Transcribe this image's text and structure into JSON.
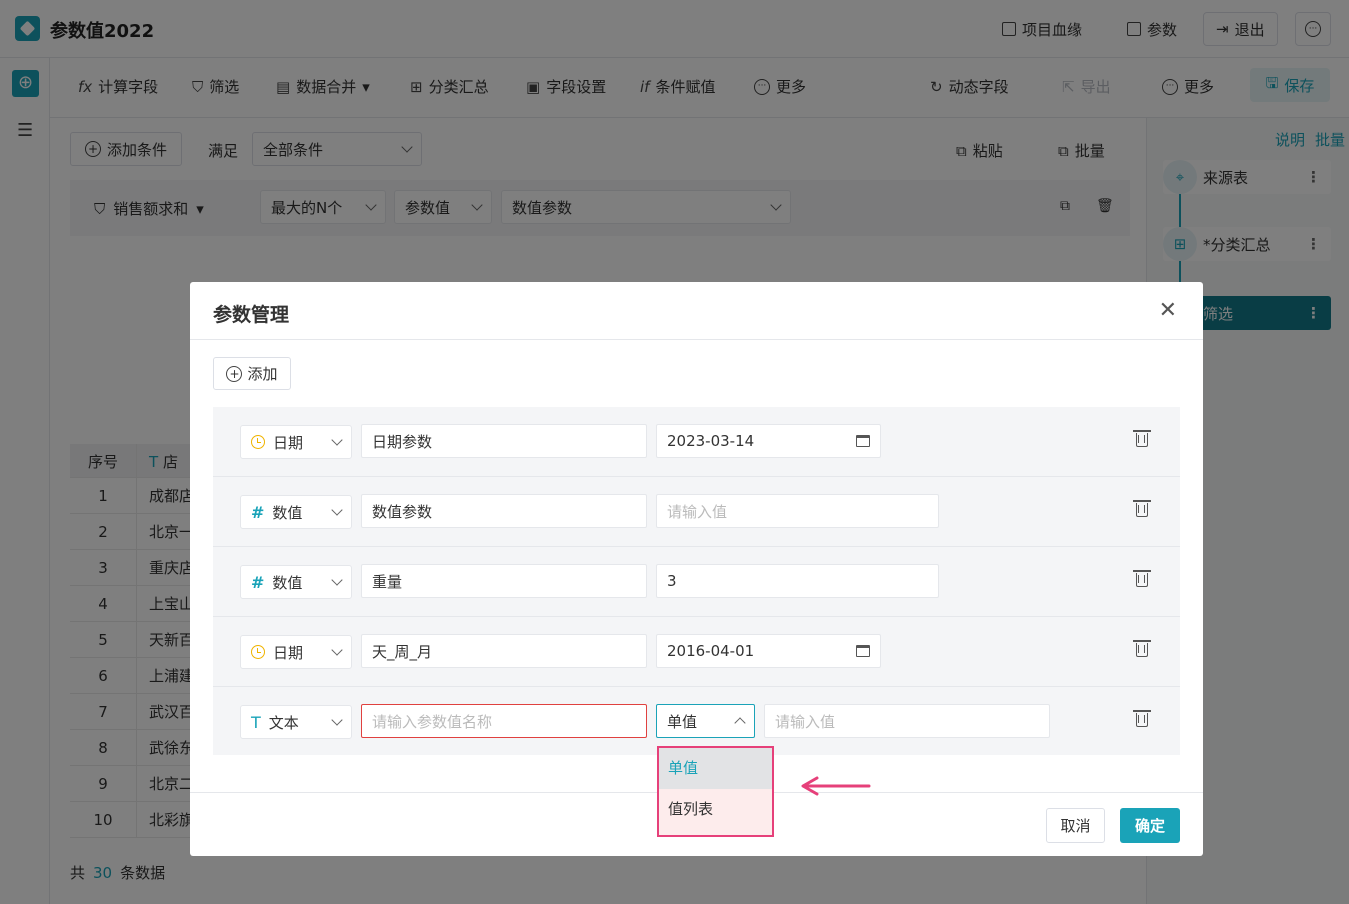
{
  "header": {
    "title": "参数值2022",
    "lineage_label": "项目血缘",
    "params_label": "参数",
    "exit_label": "退出"
  },
  "toolbar": {
    "calc_field": "计算字段",
    "filter": "筛选",
    "merge": "数据合并",
    "group_sum": "分类汇总",
    "field_settings": "字段设置",
    "conditional_assign": "条件赋值",
    "more": "更多",
    "dynamic_field": "动态字段",
    "export": "导出",
    "more2": "更多",
    "save": "保存"
  },
  "conditions": {
    "add_condition": "添加条件",
    "satisfy_label": "满足",
    "satisfy_value": "全部条件",
    "paste": "粘贴",
    "batch": "批量",
    "row": {
      "field": "销售额求和",
      "operator": "最大的N个",
      "value_type": "参数值",
      "param": "数值参数"
    }
  },
  "table": {
    "headers": [
      "序号",
      "店"
    ],
    "rows": [
      [
        "1",
        "成都店"
      ],
      [
        "2",
        "北京一"
      ],
      [
        "3",
        "重庆店"
      ],
      [
        "4",
        "上宝山"
      ],
      [
        "5",
        "天新百"
      ],
      [
        "6",
        "上浦建"
      ],
      [
        "7",
        "武汉百"
      ],
      [
        "8",
        "武徐东"
      ],
      [
        "9",
        "北京二"
      ],
      [
        "10",
        "北彩旗"
      ]
    ],
    "footer_prefix": "共",
    "footer_count": "30",
    "footer_suffix": "条数据"
  },
  "flow": {
    "explain": "说明",
    "batch": "批量",
    "nodes": [
      "来源表",
      "*分类汇总",
      "筛选"
    ]
  },
  "dialog": {
    "title": "参数管理",
    "add": "添加",
    "params": [
      {
        "type": "日期",
        "type_icon": "clock-icon",
        "name": "日期参数",
        "value": "2023-03-14",
        "placeholder": ""
      },
      {
        "type": "数值",
        "type_icon": "hash-icon",
        "name": "数值参数",
        "value": "",
        "placeholder": "请输入值"
      },
      {
        "type": "数值",
        "type_icon": "hash-icon",
        "name": "重量",
        "value": "3",
        "placeholder": ""
      },
      {
        "type": "日期",
        "type_icon": "clock-icon",
        "name": "天_周_月",
        "value": "2016-04-01",
        "placeholder": ""
      },
      {
        "type": "文本",
        "type_icon": "text-icon",
        "name": "",
        "name_placeholder": "请输入参数值名称",
        "mode": "单值",
        "value": "",
        "placeholder": "请输入值"
      }
    ],
    "dropdown_options": [
      "单值",
      "值列表"
    ],
    "cancel": "取消",
    "confirm": "确定"
  },
  "colors": {
    "accent": "#1aa3b8",
    "highlight_border": "#e6407a",
    "error_border": "#e0413f"
  }
}
